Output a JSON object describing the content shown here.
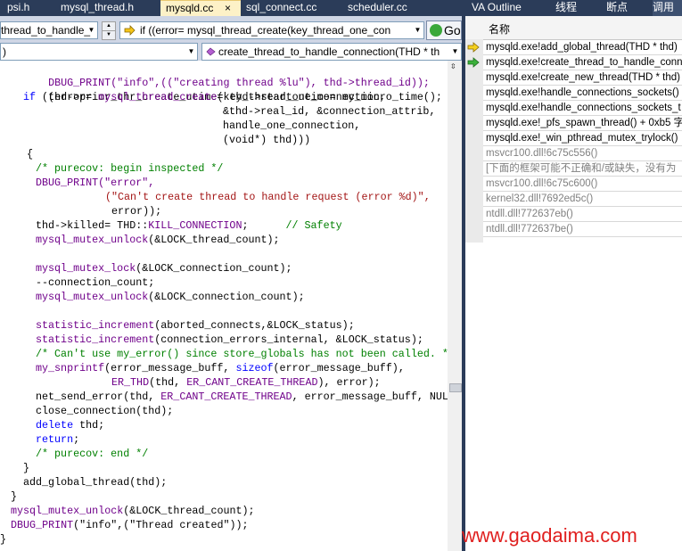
{
  "tabs": {
    "psi": "psi.h",
    "mysql_thread": "mysql_thread.h",
    "mysqld": "mysqld.cc",
    "close": "×",
    "sql_connect": "sql_connect.cc",
    "scheduler": "scheduler.cc",
    "va_outline": "VA Outline",
    "threads": "线程",
    "breakpoints": "断点",
    "call_stack": "调用"
  },
  "navbar": {
    "scope_combo": "thread_to_handle_",
    "line_combo": "if ((error= mysql_thread_create(key_thread_one_con",
    "func_combo": "create_thread_to_handle_connection(THD * th",
    "go_label": "Go"
  },
  "code": {
    "l1": "DBUG_PRINT(\"info\",((\"creating thread %lu\"), thd->thread_id));",
    "l2": "thd->prior_thr_create_utime= thd->start_utime= my_micro_time();",
    "l3a": "if",
    "l3b": " ((error= ",
    "l3c": "mysql_thread_create",
    "l3d": "(key_thread_one_connection,",
    "l4": "&thd->real_id, &connection_attrib,",
    "l5": "handle_one_connection,",
    "l6": "(void*) thd)))",
    "l7": "{",
    "l8": "/* purecov: begin inspected */",
    "l9": "DBUG_PRINT(\"error\",",
    "l10": "(\"Can't create thread to handle request (error %d)\",",
    "l11": "error));",
    "l12a": "thd->killed= THD::",
    "l12b": "KILL_CONNECTION",
    "l12c": ";",
    "l12d": "// Safety",
    "l13a": "mysql_mutex_unlock",
    "l13b": "(&LOCK_thread_count);",
    "l14a": "mysql_mutex_lock",
    "l14b": "(&LOCK_connection_count);",
    "l15": "--connection_count;",
    "l16a": "mysql_mutex_unlock",
    "l16b": "(&LOCK_connection_count);",
    "l17a": "statistic_increment",
    "l17b": "(aborted_connects,&LOCK_status);",
    "l18a": "statistic_increment",
    "l18b": "(connection_errors_internal, &LOCK_status);",
    "l19": "/* Can't use my_error() since store_globals has not been called. *",
    "l20a": "my_snprintf",
    "l20b": "(error_message_buff, ",
    "l20c": "sizeof",
    "l20d": "(error_message_buff),",
    "l21a": "ER_THD",
    "l21b": "(thd, ",
    "l21c": "ER_CANT_CREATE_THREAD",
    "l21d": "), error);",
    "l22a": "net_send_error(thd, ",
    "l22b": "ER_CANT_CREATE_THREAD",
    "l22c": ", error_message_buff, NUL",
    "l23": "close_connection(thd);",
    "l24a": "delete",
    "l24b": " thd;",
    "l25a": "return",
    "l25b": ";",
    "l26": "/* purecov: end */",
    "l27": "}",
    "l28": "add_global_thread(thd);",
    "l29": "}",
    "l30a": "mysql_mutex_unlock",
    "l30b": "(&LOCK_thread_count);",
    "l31a": "DBUG_PRINT",
    "l31b": "(\"info\",(\"Thread created\"));",
    "l32": "}",
    "l0": ")"
  },
  "callstack": {
    "header": "名称",
    "frames": [
      "mysqld.exe!add_global_thread(THD * thd)",
      "mysqld.exe!create_thread_to_handle_conn",
      "mysqld.exe!create_new_thread(THD * thd)",
      "mysqld.exe!handle_connections_sockets()",
      "mysqld.exe!handle_connections_sockets_t",
      "mysqld.exe!_pfs_spawn_thread()  + 0xb5 字",
      "mysqld.exe!_win_pthread_mutex_trylock()",
      "msvcr100.dll!6c75c556()",
      "[下面的框架可能不正确和/或缺失，没有为",
      "msvcr100.dll!6c75c600()",
      "kernel32.dll!7692ed5c()",
      "ntdll.dll!772637eb()",
      "ntdll.dll!772637be()"
    ]
  },
  "watermark": "www.gaodaima.com",
  "colors": {
    "tab_bar": "#2b3c59",
    "active_tab": "#fdf1c7",
    "keyword": "#0000ff",
    "macro": "#6f008a",
    "string": "#a31515",
    "comment": "#008000",
    "watermark": "#e0201f"
  },
  "icons": {
    "current_frame": "yellow-arrow-icon",
    "return_frame": "green-arrow-icon",
    "go": "go-icon",
    "nav": "arrow-right-icon",
    "method": "method-icon"
  }
}
